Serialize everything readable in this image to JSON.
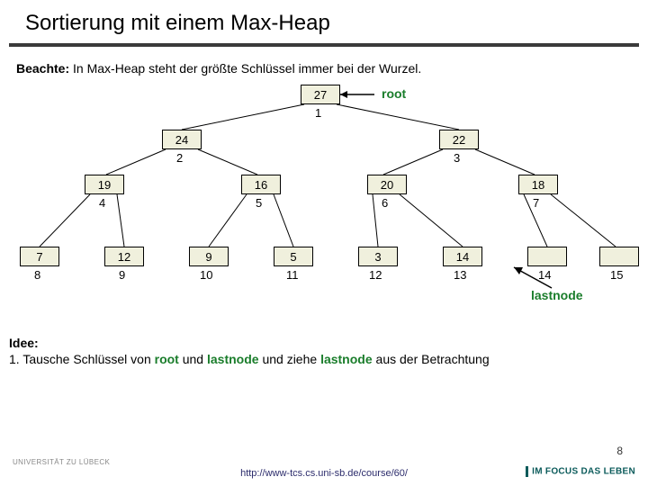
{
  "title": "Sortierung mit einem Max-Heap",
  "note_label": "Beachte:",
  "note_text": "In Max-Heap steht der größte Schlüssel immer bei der Wurzel.",
  "root_label": "root",
  "lastnode_label": "lastnode",
  "idea_label": "Idee:",
  "idea_line": "1. Tausche Schlüssel von ",
  "idea_root": "root",
  "idea_und": " und ",
  "idea_lastnode": "lastnode",
  "idea_rest": " und ziehe ",
  "idea_lastnode2": "lastnode",
  "idea_end": " aus der Betrachtung",
  "footer_url": "http://www-tcs.cs.uni-sb.de/course/60/",
  "page_number": "8",
  "logo_left": "UNIVERSITÄT ZU LÜBECK",
  "logo_right": "IM FOCUS DAS LEBEN",
  "nodes": {
    "n1": {
      "key": "27",
      "idx": "1"
    },
    "n2": {
      "key": "24",
      "idx": "2"
    },
    "n3": {
      "key": "22",
      "idx": "3"
    },
    "n4": {
      "key": "19",
      "idx": "4"
    },
    "n5": {
      "key": "16",
      "idx": "5"
    },
    "n6": {
      "key": "20",
      "idx": "6"
    },
    "n7": {
      "key": "18",
      "idx": "7"
    },
    "n8": {
      "key": "7",
      "idx": "8"
    },
    "n9": {
      "key": "12",
      "idx": "9"
    },
    "n10": {
      "key": "9",
      "idx": "10"
    },
    "n11": {
      "key": "5",
      "idx": "11"
    },
    "n12": {
      "key": "3",
      "idx": "12"
    },
    "n13": {
      "key": "14",
      "idx": "13"
    },
    "n14": {
      "key": "",
      "idx": "14"
    },
    "n15": {
      "key": "",
      "idx": "15"
    }
  },
  "chart_data": {
    "type": "tree",
    "title": "Max-Heap",
    "nodes": [
      {
        "idx": 1,
        "key": 27,
        "children": [
          2,
          3
        ]
      },
      {
        "idx": 2,
        "key": 24,
        "children": [
          4,
          5
        ]
      },
      {
        "idx": 3,
        "key": 22,
        "children": [
          6,
          7
        ]
      },
      {
        "idx": 4,
        "key": 19,
        "children": [
          8,
          9
        ]
      },
      {
        "idx": 5,
        "key": 16,
        "children": [
          10,
          11
        ]
      },
      {
        "idx": 6,
        "key": 20,
        "children": [
          12,
          13
        ]
      },
      {
        "idx": 7,
        "key": 18,
        "children": [
          14,
          15
        ]
      },
      {
        "idx": 8,
        "key": 7
      },
      {
        "idx": 9,
        "key": 12
      },
      {
        "idx": 10,
        "key": 9
      },
      {
        "idx": 11,
        "key": 5
      },
      {
        "idx": 12,
        "key": 3
      },
      {
        "idx": 13,
        "key": 14
      },
      {
        "idx": 14,
        "key": null
      },
      {
        "idx": 15,
        "key": null
      }
    ],
    "root_annotation": "root",
    "lastnode_annotation": "lastnode",
    "lastnode_idx": 13
  }
}
